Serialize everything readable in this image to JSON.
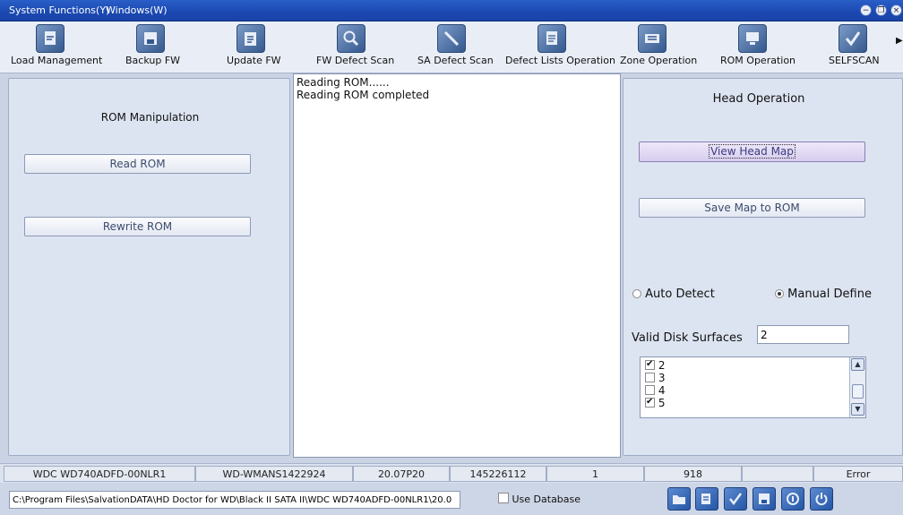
{
  "menu": {
    "system_functions": "System Functions(Y)",
    "windows": "Windows(W)"
  },
  "window_controls": {
    "minimize": "−",
    "restore": "❐",
    "close": "×"
  },
  "toolbar": {
    "items": [
      {
        "label": "Load Management",
        "icon": "load-management-icon"
      },
      {
        "label": "Backup FW",
        "icon": "backup-fw-icon"
      },
      {
        "label": "Update FW",
        "icon": "update-fw-icon"
      },
      {
        "label": "FW Defect Scan",
        "icon": "fw-defect-scan-icon"
      },
      {
        "label": "SA Defect Scan",
        "icon": "sa-defect-scan-icon"
      },
      {
        "label": "Defect Lists Operation",
        "icon": "defect-lists-icon"
      },
      {
        "label": "Zone Operation",
        "icon": "zone-operation-icon"
      },
      {
        "label": "ROM Operation",
        "icon": "rom-operation-icon"
      },
      {
        "label": "SELFSCAN",
        "icon": "selfscan-icon"
      }
    ],
    "more_arrow": "▶"
  },
  "left_panel": {
    "title": "ROM Manipulation",
    "read_rom": "Read ROM",
    "rewrite_rom": "Rewrite ROM"
  },
  "log": {
    "lines": [
      "Reading ROM......",
      "Reading ROM completed"
    ]
  },
  "right_panel": {
    "title": "Head Operation",
    "view_head_map": "View Head Map",
    "save_map": "Save Map to ROM",
    "auto_detect": "Auto Detect",
    "manual_define": "Manual Define",
    "selected_mode": "manual",
    "valid_surfaces_label": "Valid Disk Surfaces",
    "valid_surfaces_value": "2",
    "surfaces": [
      {
        "label": "2",
        "checked": true
      },
      {
        "label": "3",
        "checked": false
      },
      {
        "label": "4",
        "checked": false
      },
      {
        "label": "5",
        "checked": true
      }
    ]
  },
  "status": {
    "model": "WDC WD740ADFD-00NLR1",
    "serial": "WD-WMANS1422924",
    "firmware": "20.07P20",
    "lba": "145226112",
    "heads": "1",
    "value": "918",
    "empty": "",
    "state": "Error"
  },
  "bottom": {
    "path": "C:\\Program Files\\SalvationDATA\\HD Doctor for WD\\Black II SATA II\\WDC WD740ADFD-00NLR1\\20.0",
    "use_database": "Use Database",
    "use_database_checked": false,
    "buttons": [
      "open-folder-icon",
      "edit-icon",
      "check-icon",
      "save-icon",
      "info-icon",
      "power-icon"
    ]
  },
  "colors": {
    "titlebar": "#1a48b0",
    "panel": "#dde4f1",
    "background": "#c9d3e3",
    "highlight_button": "#d6cdee"
  }
}
